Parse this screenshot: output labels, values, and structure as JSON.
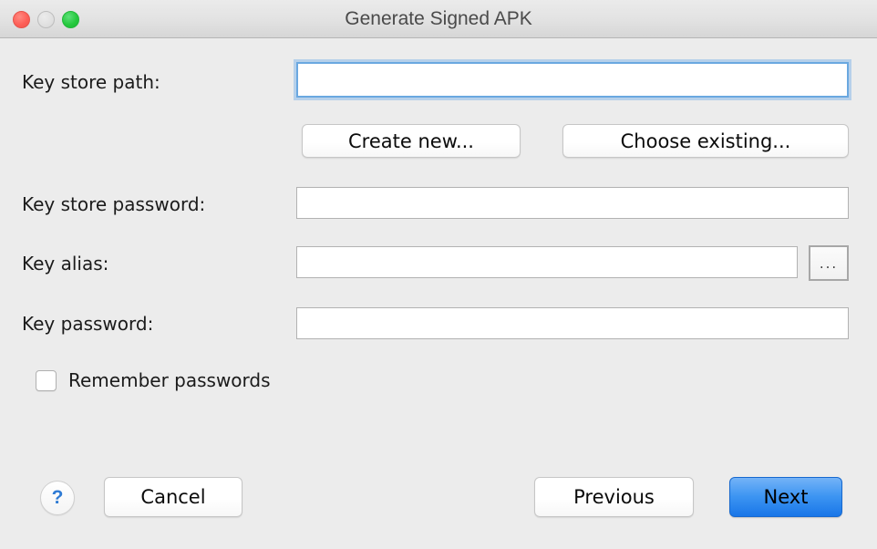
{
  "window": {
    "title": "Generate Signed APK",
    "traffic_lights": [
      {
        "name": "close-button",
        "color": "#fd6058"
      },
      {
        "name": "minimize-button",
        "color": "#e0e0e0"
      },
      {
        "name": "zoom-button",
        "color": "#27c93f"
      }
    ]
  },
  "form": {
    "key_store_path": {
      "label": "Key store path:",
      "value": "",
      "placeholder": ""
    },
    "create_new_label": "Create new...",
    "choose_existing_label": "Choose existing...",
    "key_store_password": {
      "label": "Key store password:",
      "value": "",
      "placeholder": ""
    },
    "key_alias": {
      "label": "Key alias:",
      "value": "",
      "placeholder": "",
      "browse_label": "..."
    },
    "key_password": {
      "label": "Key password:",
      "value": "",
      "placeholder": ""
    },
    "remember_passwords": {
      "label": "Remember passwords",
      "checked": false
    }
  },
  "footer": {
    "help_label": "?",
    "cancel_label": "Cancel",
    "previous_label": "Previous",
    "next_label": "Next"
  },
  "colors": {
    "background": "#ececec",
    "accent_blue": "#3d95f2",
    "focus_ring": "#8abaea",
    "help_blue": "#2f7bd4"
  }
}
